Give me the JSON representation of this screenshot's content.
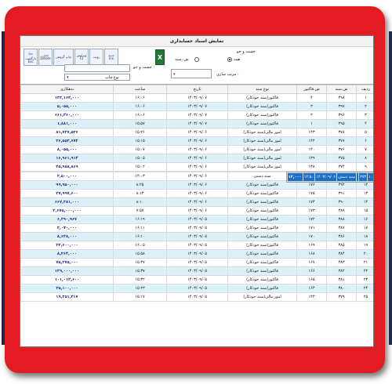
{
  "window": {
    "title": "نمایش اسناد حسابداری"
  },
  "toolbar": {
    "exit": {
      "label": "بازگشت",
      "sub": "Esc"
    },
    "delete": {
      "label": "حذف",
      "sub": "Delete"
    },
    "print_group": {
      "label": "چاپ گروهی"
    },
    "edit": {
      "label": "ویرایش",
      "sub": "F2"
    },
    "view": {
      "label": "رویت"
    },
    "new": {
      "label": "جدید",
      "sub": "Ins"
    },
    "excel": {
      "label": "X"
    }
  },
  "filters": {
    "search_group_label": "جست و جو",
    "radio_all": "همه",
    "radio_doc_no": "ش. سند",
    "search_label": "جست و جو :",
    "sort_label": "مرتب سازی :",
    "print_type_label": "نوع چاپ"
  },
  "table": {
    "headers": [
      "ردیف",
      "ش.سند",
      "ش.فاکتور",
      "نوع سند",
      "تاریخ",
      "ساعت",
      "بدهکاری"
    ],
    "rows": [
      [
        "۱",
        "۳۹۸",
        "۴",
        "فاکتور(سند خودکار)",
        "۱۴۰۳/۰۹/۰۷",
        "۱۶:۰۶",
        "۱۳۳,۱۶۳,۰۰۰"
      ],
      [
        "۲",
        "۳۹۷",
        "۳",
        "فاکتور(سند خودکار)",
        "۱۴۰۳/۰۹/۰۷",
        "۱۶:۰۶",
        "۵,۰۵۵,۰۰۰"
      ],
      [
        "۳",
        "۳۹۶",
        "۲",
        "فاکتور(سند خودکار)",
        "۱۴۰۳/۰۹/۰۷",
        "۱۶:۰۶",
        "۶۶۱,۴۶۰,۰۰۰"
      ],
      [
        "۴",
        "۳۹۵",
        "۱",
        "فاکتور(سند خودکار)",
        "۱۴۰۳/۰۹/۰۷",
        "۱۵:۵۷",
        "۱,۸۸۱,۰۰۰"
      ],
      [
        "۵",
        "۳۷۸",
        "۱۴۳",
        "امور مالی(سند خودکار)",
        "۱۴۰۳/۰۹/۰۶",
        "۱۵:۲۶",
        "۸۱,۷۲۷,۵۳۶"
      ],
      [
        "۶",
        "۳۷۷",
        "۱۴۲",
        "امور مالی(سند خودکار)",
        "۱۴۰۳/۰۹/۰۶",
        "۱۵:۱۵",
        "۳۶,۵۵۳,۶۷۲"
      ],
      [
        "۷",
        "۳۷۶",
        "۱۴۰",
        "امور مالی(سند خودکار)",
        "۱۴۰۳/۰۹/۰۶",
        "۱۵:۰۷",
        "۸,۰۵۵,۰۰۰"
      ],
      [
        "۸",
        "۳۷۵",
        "۱۳۹",
        "امور مالی(سند خودکار)",
        "۱۴۰۳/۰۹/۰۶",
        "۱۵:۰۵",
        "۱۶,۹۶۱,۹۱۴"
      ],
      [
        "۹",
        "۳۷۴",
        "۱۳۸",
        "امور مالی(سند خودکار)",
        "۱۴۰۳/۰۹/۰۶",
        "۱۵:۰۲",
        "۴۵,۹۸۸,۸۶۹"
      ],
      [
        "۱۰",
        "۳۷۳",
        "",
        "سند دستی",
        "۱۴۰۳/۰۹/۰۶",
        "۱۴:۵۰",
        "۱۲,۰۰۰"
      ],
      [
        "۱۱",
        "۳۷۲",
        "",
        "سند دستی",
        "۱۴۰۳/۰۹/۰۶",
        "۱۴:۰۳",
        "۲,۵۰۰,۰۰۰"
      ],
      [
        "۱۲",
        "۳۹۲",
        "۱۷۶",
        "فاکتور(سند خودکار)",
        "۱۴۰۳/۰۹/۰۶",
        "۸:۲۵",
        "۹۹,۹۵۰,۰۰۰"
      ],
      [
        "۱۳",
        "۳۹۱",
        "۱۷۵",
        "فاکتور(سند خودکار)",
        "۱۴۰۳/۰۹/۰۶",
        "۸:۱۳",
        "۳۷,۹۹۷,۶۰۰"
      ],
      [
        "۱۴",
        "۳۹۰",
        "۱۷۴",
        "فاکتور(سند خودکار)",
        "۱۴۰۳/۰۹/۰۶",
        "۸:۱۰",
        "۶۶۷,۳۸۱,۰۰۰"
      ],
      [
        "۱۵",
        "۳۸۹",
        "۱۷۳",
        "فاکتور(سند خودکار)",
        "۱۴۰۳/۰۹/۰۶",
        "۷:۵۷",
        "۲,۶۷۵,۰۰۰,۰۰۰"
      ],
      [
        "۱۶",
        "۳۸۸",
        "۱۷۲",
        "فاکتور(سند خودکار)",
        "۱۴۰۳/۰۹/۰۵",
        "۱۶:۱۹",
        "۶,۳۹۰,۹۶۷"
      ],
      [
        "۱۷",
        "۳۸۷",
        "۱۷۱",
        "فاکتور(سند خودکار)",
        "۱۴۰۳/۰۹/۰۵",
        "۱۶:۱۱",
        "۳,۰۷۰,۰۰۰"
      ],
      [
        "۱۸",
        "۳۸۶",
        "۱۷۰",
        "فاکتور(سند خودکار)",
        "۱۴۰۳/۰۹/۰۵",
        "۱۶:۱۰",
        "۸,۶۳۸,۰۰۰"
      ],
      [
        "۱۹",
        "۳۸۵",
        "۱۶۹",
        "فاکتور(سند خودکار)",
        "۱۴۰۳/۰۹/۰۵",
        "۱۶:۰۵",
        "۲۳,۶۰۰,۰۰۰"
      ],
      [
        "۲۰",
        "۳۸۴",
        "۱۶۸",
        "فاکتور(سند خودکار)",
        "۱۴۰۳/۰۹/۰۵",
        "۱۵:۵۸",
        "۸,۳۶۴,۰۰۰"
      ],
      [
        "۲۱",
        "۳۸۳",
        "۱۶۷",
        "فاکتور(سند خودکار)",
        "۱۴۰۳/۰۹/۰۵",
        "۱۵:۴۷",
        "۷۵,۳۷۵,۰۰۰"
      ],
      [
        "۲۲",
        "۳۸۲",
        "۱۶۶",
        "فاکتور(سند خودکار)",
        "۱۴۰۳/۰۹/۰۵",
        "۱۵:۳۷",
        "۱۳۹,۰۰۰,۰۰۰"
      ],
      [
        "۲۳",
        "۳۸۱",
        "۱۶۵",
        "فاکتور(سند خودکار)",
        "۱۴۰۳/۰۹/۰۵",
        "۱۵:۳۲",
        "۱۰۱,۰۱۲,۶۰۰"
      ],
      [
        "۲۴",
        "۳۸۰",
        "۱۶۴",
        "فاکتور(سند خودکار)",
        "۱۴۰۳/۰۹/۰۵",
        "۱۵:۲۳",
        "۳۵,۱۰۰,۰۰۰"
      ],
      [
        "۲۵",
        "۳۷۹",
        "۱۴۴",
        "امور مالی(سند خودکار)",
        "۱۴۰۳/۰۹/۰۵",
        "۱۵:۱۷",
        "۱۹,۲۵۱,۳۱۷"
      ]
    ],
    "selected_index": 9
  },
  "colors": {
    "frame": "#e31b23",
    "selected_row": "#1a6fc9",
    "stripe_row": "#ddf2f8",
    "amount_text": "#1f2d8c"
  }
}
